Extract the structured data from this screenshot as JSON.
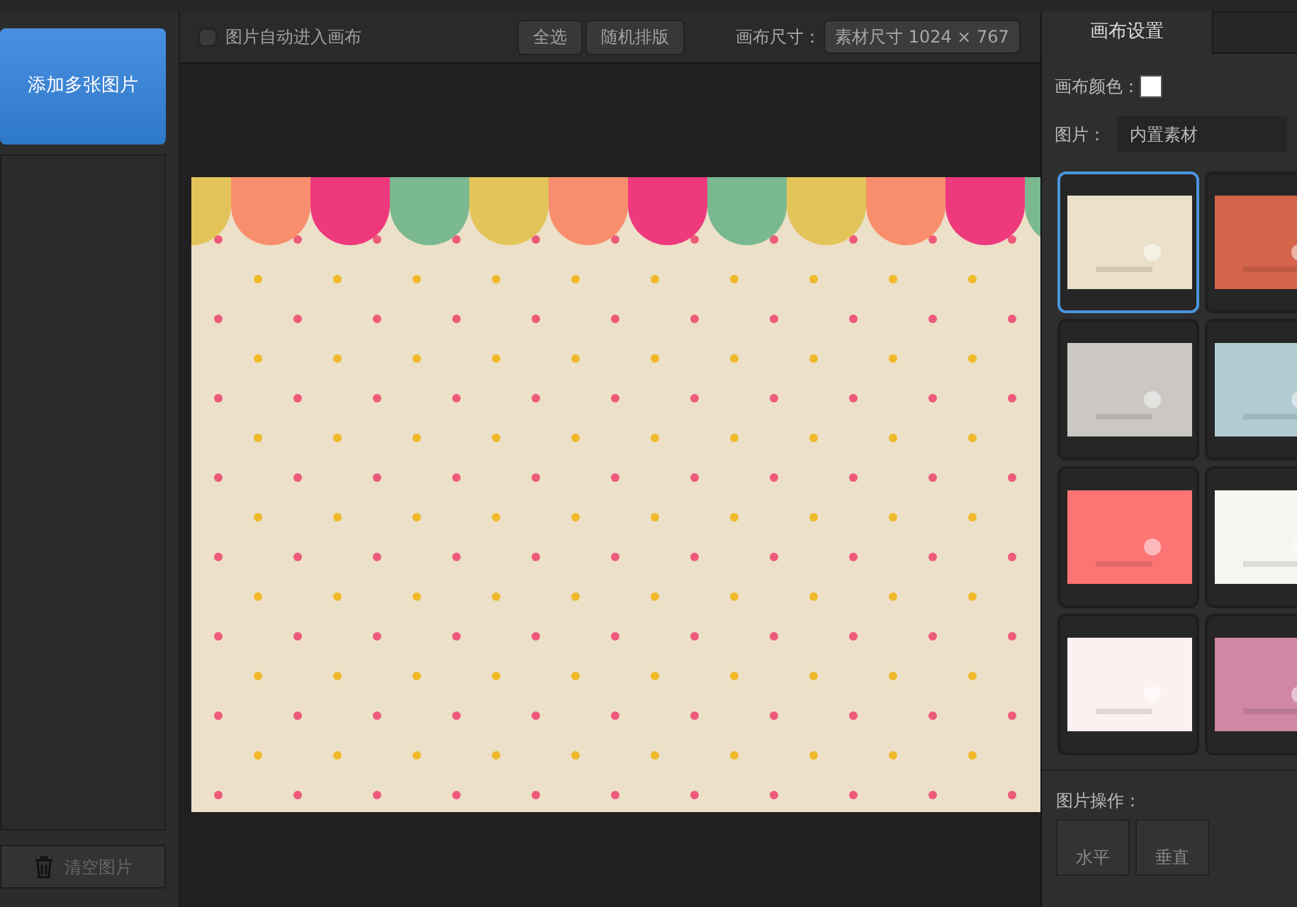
{
  "left_panel": {
    "add_button": "添加多张图片",
    "clear_button": "清空图片"
  },
  "toolbar": {
    "auto_checkbox": {
      "label": "图片自动进入画布",
      "checked": false
    },
    "buttons": [
      "全选",
      "随机排版"
    ],
    "size_label": "画布尺寸：",
    "size_select": "素材尺寸 1024 × 767"
  },
  "right_panel": {
    "tabs": [
      {
        "label": "画布设置",
        "selected": true
      },
      {
        "selected": false
      }
    ],
    "canvas_color_label": "画布颜色：",
    "image_label": "图片：",
    "image_select": "内置素材",
    "thumbnails": [
      {
        "color": "#ebe0c8",
        "selected": true
      },
      {
        "color": "#d4644a",
        "selected": false
      },
      {
        "color": "#cbc7c2",
        "selected": false
      },
      {
        "color": "#b1cbd3",
        "selected": false
      },
      {
        "color": "#fc7574",
        "selected": false
      },
      {
        "color": "#f7f5f0",
        "selected": false
      },
      {
        "color": "#fdf0f0",
        "selected": false
      },
      {
        "color": "#d088a4",
        "selected": false
      }
    ],
    "operations_label": "图片操作：",
    "operation_buttons": [
      "水平",
      "垂直"
    ]
  }
}
